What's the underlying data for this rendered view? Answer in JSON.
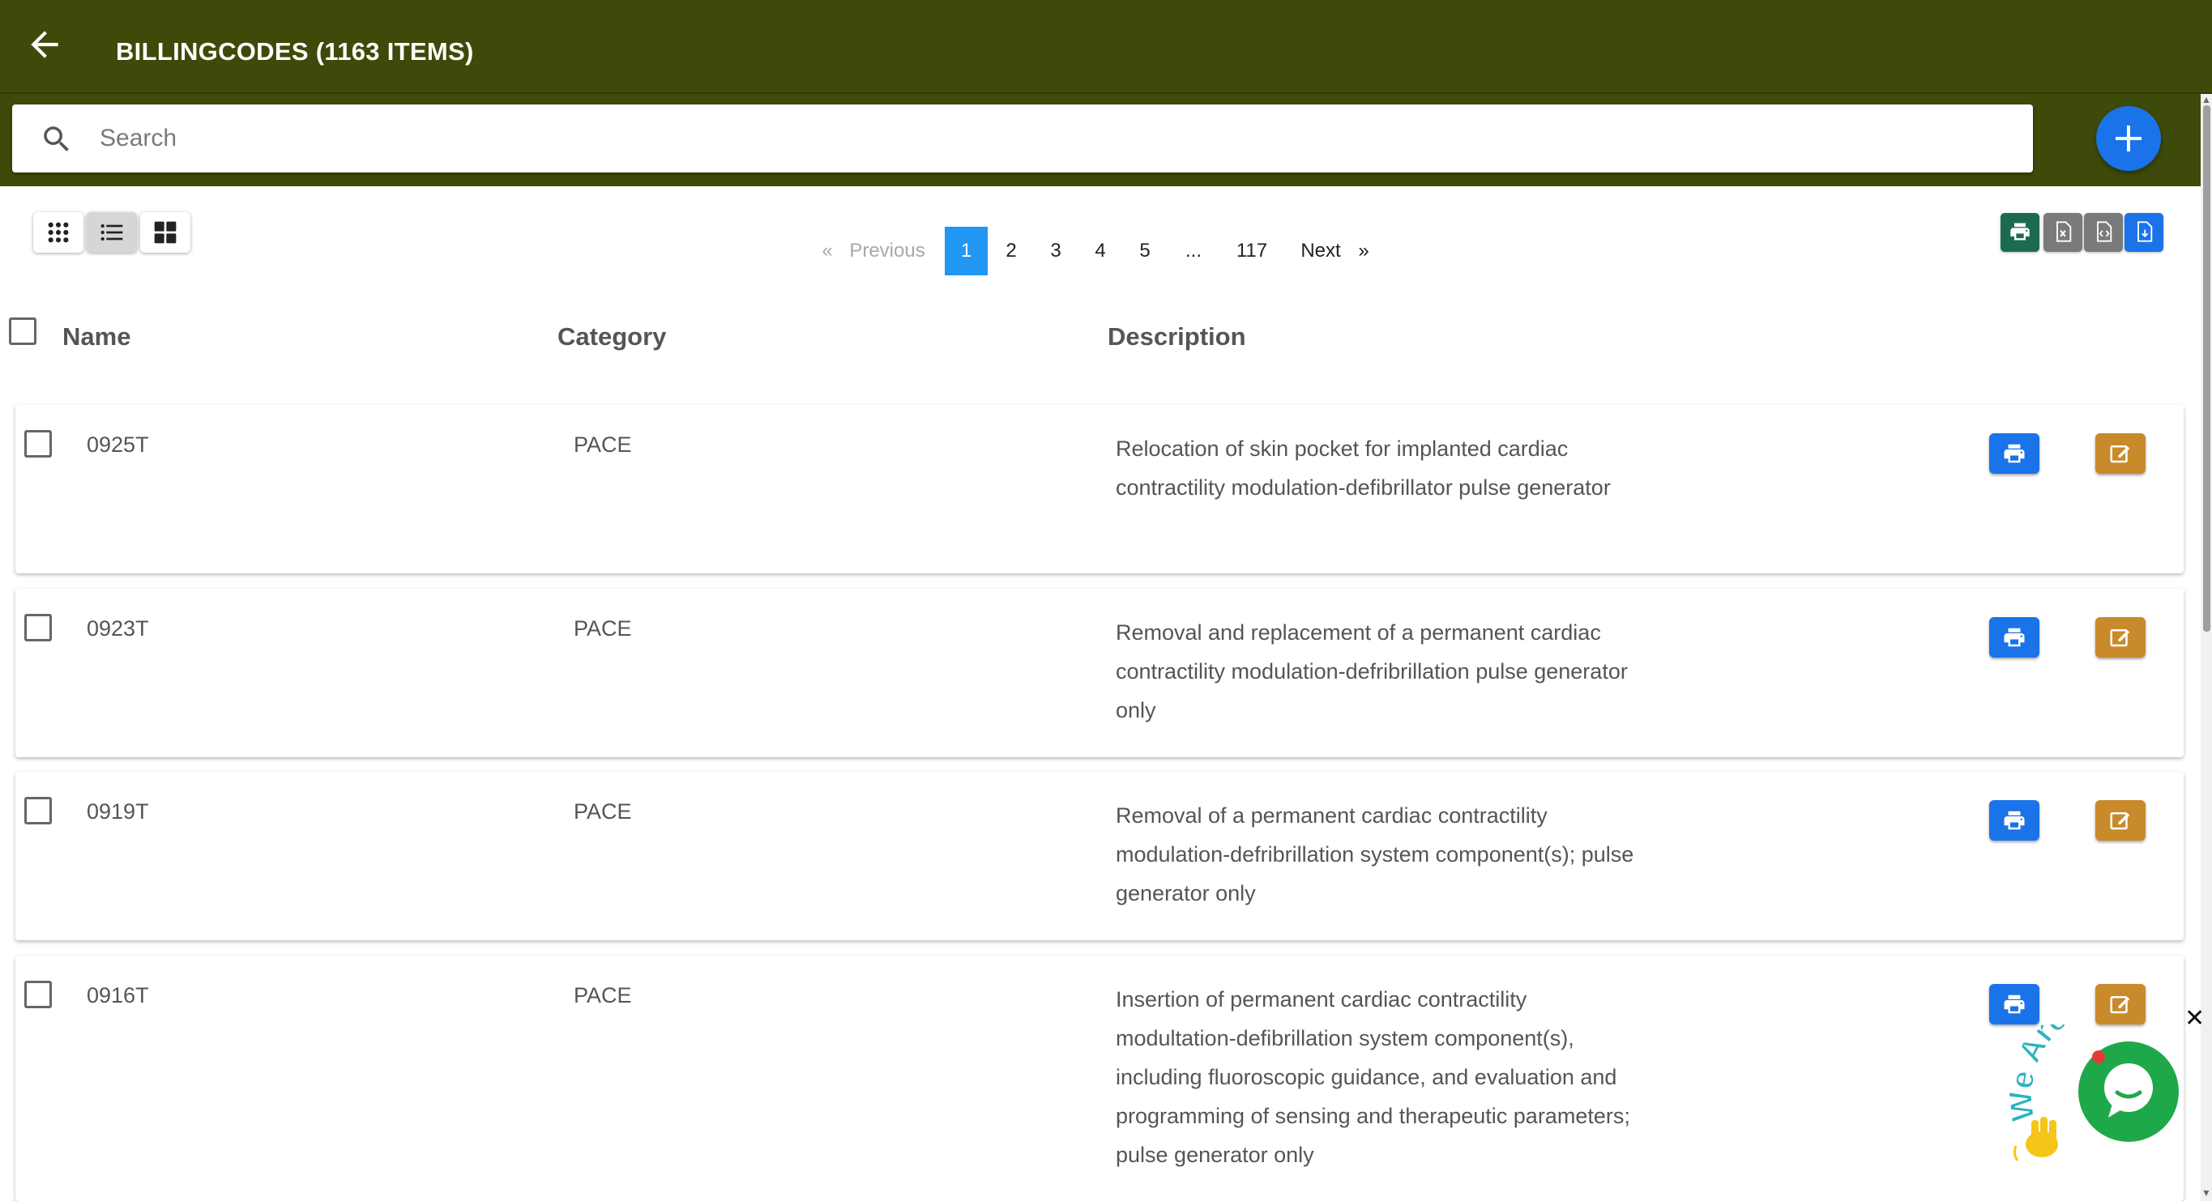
{
  "header": {
    "title": "BILLINGCODES (1163 ITEMS)",
    "back_icon": "arrow-left-icon",
    "bg_color": "#3d4a09"
  },
  "search": {
    "placeholder": "Search",
    "value": ""
  },
  "add_button": {
    "icon": "plus-icon",
    "color": "#1a73e8"
  },
  "view_toggles": [
    {
      "icon": "grid-dots-icon",
      "active": false
    },
    {
      "icon": "list-icon",
      "active": true
    },
    {
      "icon": "grid-large-icon",
      "active": false
    }
  ],
  "pagination": {
    "prev_symbol": "«",
    "prev_label": "Previous",
    "pages": [
      "1",
      "2",
      "3",
      "4",
      "5",
      "...",
      "117"
    ],
    "current": "1",
    "next_label": "Next",
    "next_symbol": "»"
  },
  "export_buttons": [
    {
      "icon": "print-icon",
      "color": "#1b6b52"
    },
    {
      "icon": "excel-file-icon",
      "color": "#7a7a7a"
    },
    {
      "icon": "code-file-icon",
      "color": "#7a7a7a"
    },
    {
      "icon": "pdf-file-icon",
      "color": "#1a73e8"
    }
  ],
  "table": {
    "columns": [
      "Name",
      "Category",
      "Description"
    ],
    "rows": [
      {
        "name": "0925T",
        "category": "PACE",
        "description": "Relocation of skin pocket for implanted cardiac contractility modulation-defibrillator pulse generator"
      },
      {
        "name": "0923T",
        "category": "PACE",
        "description": "Removal and replacement of a permanent cardiac contractility modulation-defribrillation pulse generator only"
      },
      {
        "name": "0919T",
        "category": "PACE",
        "description": "Removal of a permanent cardiac contractility modulation-defribrillation system component(s); pulse generator only"
      },
      {
        "name": "0916T",
        "category": "PACE",
        "description": "Insertion of permanent cardiac contractility modultation-defibrillation system component(s), including fluoroscopic guidance, and evaluation and programming of sensing and therapeutic parameters; pulse generator only"
      }
    ]
  },
  "chat_widget": {
    "text": "We Are Here!",
    "close_symbol": "✕",
    "color": "#1fa84a"
  }
}
